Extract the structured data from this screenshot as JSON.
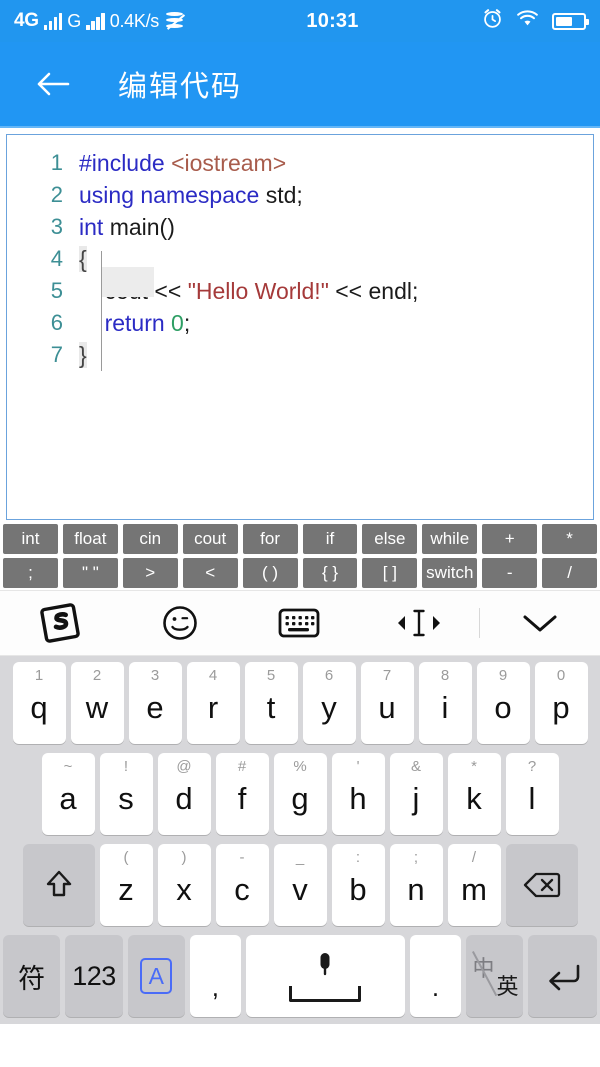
{
  "statusbar": {
    "network_type": "4G",
    "network_type2": "G",
    "data_rate": "0.4K/s",
    "time": "10:31",
    "icons": [
      "signal-bars-icon",
      "signal-bars-icon",
      "data-transfer-icon",
      "alarm-clock-icon",
      "wifi-icon",
      "battery-icon"
    ]
  },
  "appbar": {
    "back_label": "←",
    "title": "编辑代码"
  },
  "editor": {
    "lines": [
      {
        "no": "1",
        "tokens": [
          {
            "t": "#include ",
            "c": "kw"
          },
          {
            "t": "<iostream>",
            "c": "inc"
          }
        ]
      },
      {
        "no": "2",
        "tokens": [
          {
            "t": "using namespace ",
            "c": "kw"
          },
          {
            "t": "std;",
            "c": "pl"
          }
        ]
      },
      {
        "no": "3",
        "tokens": [
          {
            "t": "int ",
            "c": "kw"
          },
          {
            "t": "main()",
            "c": "pl"
          }
        ]
      },
      {
        "no": "4",
        "tokens": [
          {
            "t": "{",
            "c": "brace"
          }
        ]
      },
      {
        "no": "5",
        "tokens": [
          {
            "t": "    cout << ",
            "c": "pl"
          },
          {
            "t": "\"Hello World!\"",
            "c": "str"
          },
          {
            "t": " << endl;",
            "c": "pl"
          }
        ]
      },
      {
        "no": "6",
        "tokens": [
          {
            "t": "    ",
            "c": "pl"
          },
          {
            "t": "return ",
            "c": "kw"
          },
          {
            "t": "0",
            "c": "num"
          },
          {
            "t": ";",
            "c": "pl"
          }
        ]
      },
      {
        "no": "7",
        "tokens": [
          {
            "t": "}",
            "c": "brace"
          }
        ]
      }
    ]
  },
  "snippet_toolbar": {
    "row1": [
      "int",
      "float",
      "cin",
      "cout",
      "for",
      "if",
      "else",
      "while",
      "+",
      "*"
    ],
    "row2": [
      ";",
      "\" \"",
      ">",
      "<",
      "( )",
      "{ }",
      "[ ]",
      "switch",
      "-",
      "/"
    ]
  },
  "ime_toolbar": {
    "items": [
      {
        "name": "sogou-logo-icon",
        "label": "S"
      },
      {
        "name": "emoji-icon",
        "label": "☺"
      },
      {
        "name": "keyboard-switch-icon",
        "label": ""
      },
      {
        "name": "cursor-move-icon",
        "label": ""
      },
      {
        "name": "collapse-keyboard-icon",
        "label": ""
      }
    ]
  },
  "keyboard": {
    "row1": [
      {
        "main": "q",
        "sup": "1"
      },
      {
        "main": "w",
        "sup": "2"
      },
      {
        "main": "e",
        "sup": "3"
      },
      {
        "main": "r",
        "sup": "4"
      },
      {
        "main": "t",
        "sup": "5"
      },
      {
        "main": "y",
        "sup": "6"
      },
      {
        "main": "u",
        "sup": "7"
      },
      {
        "main": "i",
        "sup": "8"
      },
      {
        "main": "o",
        "sup": "9"
      },
      {
        "main": "p",
        "sup": "0"
      }
    ],
    "row2": [
      {
        "main": "a",
        "sup": "~"
      },
      {
        "main": "s",
        "sup": "!"
      },
      {
        "main": "d",
        "sup": "@"
      },
      {
        "main": "f",
        "sup": "#"
      },
      {
        "main": "g",
        "sup": "%"
      },
      {
        "main": "h",
        "sup": "'"
      },
      {
        "main": "j",
        "sup": "&"
      },
      {
        "main": "k",
        "sup": "*"
      },
      {
        "main": "l",
        "sup": "?"
      }
    ],
    "row3": [
      {
        "main": "z",
        "sup": "("
      },
      {
        "main": "x",
        "sup": ")"
      },
      {
        "main": "c",
        "sup": "-"
      },
      {
        "main": "v",
        "sup": "_"
      },
      {
        "main": "b",
        "sup": ":"
      },
      {
        "main": "n",
        "sup": ";"
      },
      {
        "main": "m",
        "sup": "/"
      }
    ],
    "shift_label": "⇧",
    "backspace_label": "⌫",
    "symbols_label": "符",
    "numbers_label": "123",
    "caps_label": "A",
    "comma_label": ",",
    "period_label": ".",
    "space_label": "",
    "lang_cn": "中",
    "lang_en": "英",
    "enter_label": "↵"
  },
  "colors": {
    "status_bar": "#2196ef",
    "app_bar": "#2196f3",
    "editor_border": "#6ba3dd",
    "snippet_bg": "#757575",
    "keyboard_bg": "#d7d7da",
    "keyword": "#2b2bc4",
    "string": "#a53a3a",
    "include": "#a85c4c",
    "number": "#2e9e64",
    "lineno": "#3d8f95"
  }
}
